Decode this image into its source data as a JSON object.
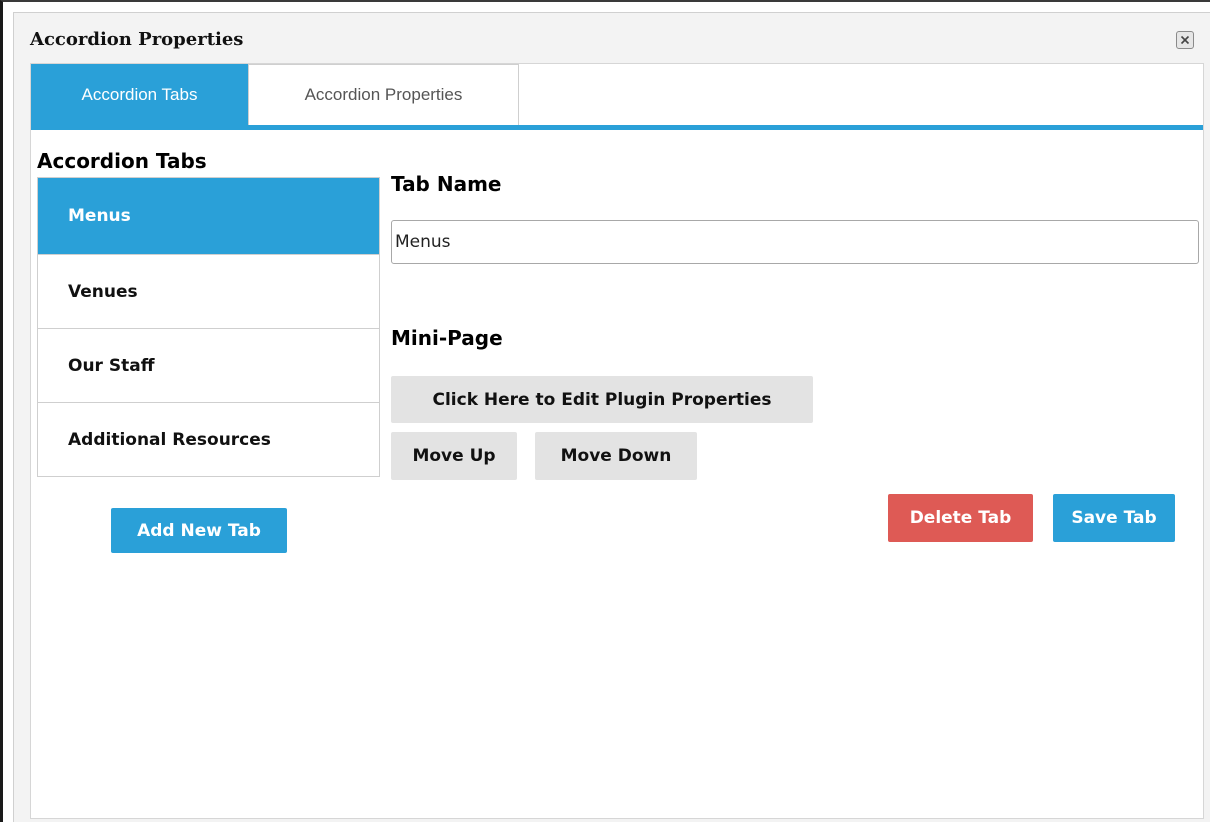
{
  "window": {
    "title": "Accordion Properties",
    "close_icon": "close-icon"
  },
  "tabs": [
    {
      "label": "Accordion Tabs",
      "active": true
    },
    {
      "label": "Accordion Properties",
      "active": false
    }
  ],
  "sidebar": {
    "heading": "Accordion Tabs",
    "items": [
      {
        "label": "Menus",
        "selected": true
      },
      {
        "label": "Venues",
        "selected": false
      },
      {
        "label": "Our Staff",
        "selected": false
      },
      {
        "label": "Additional Resources",
        "selected": false
      }
    ],
    "add_button_label": "Add New Tab"
  },
  "editor": {
    "tab_name_label": "Tab Name",
    "tab_name_value": "Menus",
    "mini_page_label": "Mini-Page",
    "edit_plugin_label": "Click Here to Edit Plugin Properties",
    "move_up_label": "Move Up",
    "move_down_label": "Move Down",
    "delete_label": "Delete Tab",
    "save_label": "Save Tab"
  },
  "colors": {
    "accent": "#2aa0d8",
    "danger": "#de5a55",
    "neutral_button": "#e3e3e3"
  }
}
